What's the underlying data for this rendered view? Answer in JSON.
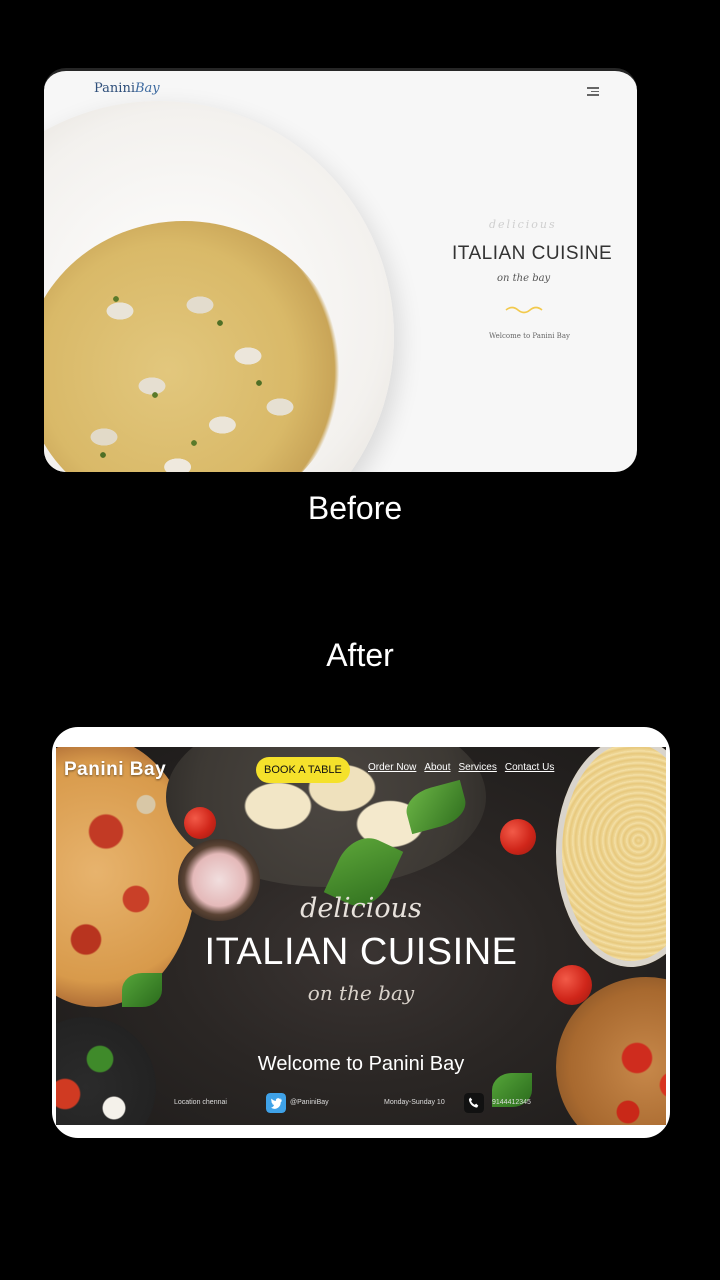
{
  "before": {
    "label": "Before",
    "logo_main": "Panini",
    "logo_script": "Bay",
    "icons": {
      "menu": "hamburger-menu-icon"
    },
    "delicious": "delicious",
    "title": "ITALIAN CUISINE",
    "subtitle": "on the bay",
    "welcome": "Welcome to Panini Bay",
    "colors": {
      "background": "#f7f7f7",
      "title": "#333333",
      "accent": "#f2c94c"
    }
  },
  "after": {
    "label": "After",
    "logo": "Panini Bay",
    "book_button": "BOOK A TABLE",
    "nav": [
      "Order Now",
      "About",
      "Services",
      "Contact Us"
    ],
    "delicious": "delicious",
    "title": "ITALIAN CUISINE",
    "subtitle": "on the bay",
    "welcome": "Welcome to Panini Bay",
    "footer": {
      "location": "Location chennai",
      "twitter_handle": "@PaniniBay",
      "hours": "Monday-Sunday 10",
      "phone": "9144412345"
    },
    "icons": {
      "twitter": "twitter-icon",
      "phone": "phone-icon"
    },
    "colors": {
      "book_button": "#f5e12b",
      "background": "#2a2624",
      "text": "#ffffff"
    }
  }
}
